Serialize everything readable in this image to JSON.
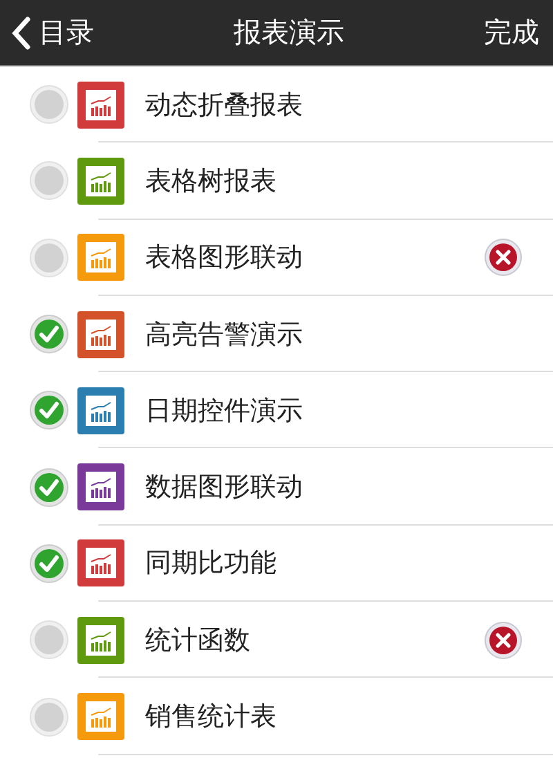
{
  "nav_bar": {
    "back_label": "目录",
    "title": "报表演示",
    "done_label": "完成"
  },
  "items": [
    {
      "label": "动态折叠报表",
      "checked": false,
      "color": "#d23b3b",
      "delete_button": false
    },
    {
      "label": "表格树报表",
      "checked": false,
      "color": "#5f9a0e",
      "delete_button": false
    },
    {
      "label": "表格图形联动",
      "checked": false,
      "color": "#f59a0c",
      "delete_button": true
    },
    {
      "label": "高亮告警演示",
      "checked": true,
      "color": "#d4522a",
      "delete_button": false
    },
    {
      "label": "日期控件演示",
      "checked": true,
      "color": "#2a7fb0",
      "delete_button": false
    },
    {
      "label": "数据图形联动",
      "checked": true,
      "color": "#7a3a9a",
      "delete_button": false
    },
    {
      "label": "同期比功能",
      "checked": true,
      "color": "#d23b3b",
      "delete_button": false
    },
    {
      "label": "统计函数",
      "checked": false,
      "color": "#5f9a0e",
      "delete_button": true
    },
    {
      "label": "销售统计表",
      "checked": false,
      "color": "#f59a0c",
      "delete_button": false
    }
  ]
}
